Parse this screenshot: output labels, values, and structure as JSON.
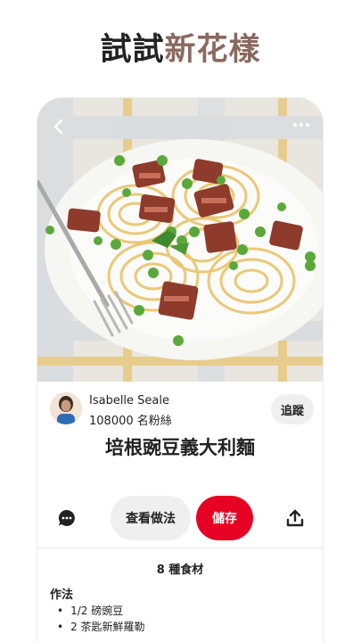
{
  "headline": {
    "part1": "試試",
    "part2": "新花樣"
  },
  "author": {
    "name": "Isabelle Seale",
    "followers": "108000 名粉絲",
    "follow_label": "追蹤"
  },
  "pin": {
    "title": "培根豌豆義大利麵"
  },
  "actions": {
    "recipe_label": "查看做法",
    "save_label": "儲存"
  },
  "recipe": {
    "ingredients_count": "8 種食材",
    "method_heading": "作法",
    "ingredients": [
      "1/2 磅豌豆",
      "2 茶匙新鮮羅勒"
    ]
  },
  "icons": {
    "back": "chevron-left-icon",
    "more": "more-horizontal-icon",
    "comment": "comment-icon",
    "share": "share-icon"
  },
  "colors": {
    "brand_red": "#e60023",
    "headline_accent": "#8a6a5f",
    "button_gray": "#efefef"
  }
}
